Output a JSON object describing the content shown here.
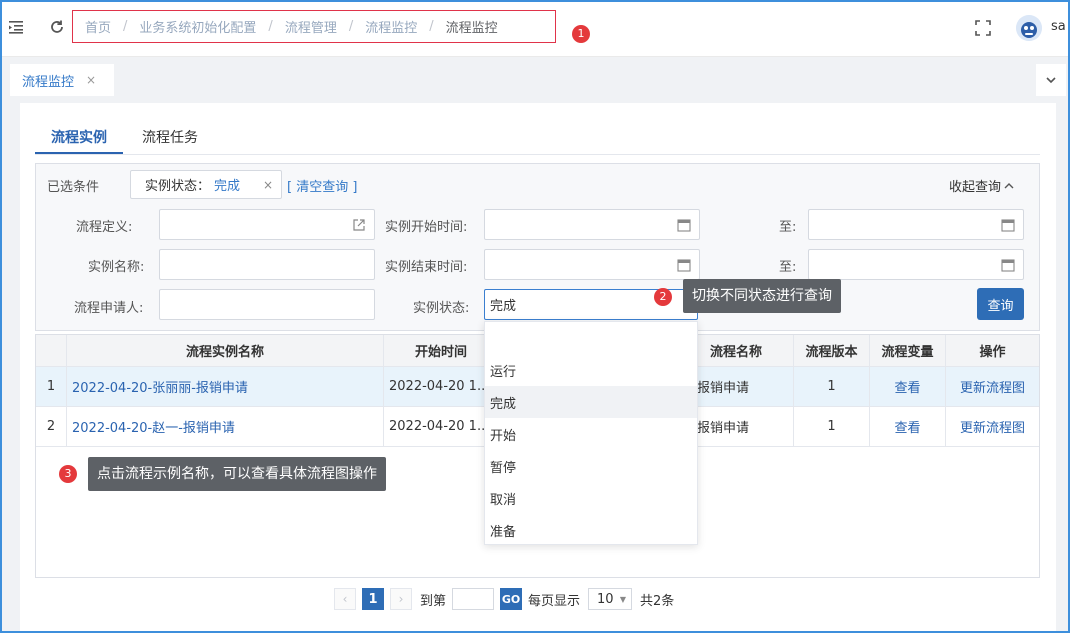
{
  "breadcrumb": [
    "首页",
    "业务系统初始化配置",
    "流程管理",
    "流程监控",
    "流程监控"
  ],
  "breadcrumb_separator": "/",
  "user": {
    "name": "sa"
  },
  "annotations": {
    "n1": "1",
    "n2": "2",
    "n3": "3"
  },
  "tips": {
    "status_switch": "切换不同状态进行查询",
    "click_name": "点击流程示例名称，可以查看具体流程图操作"
  },
  "open_tab": {
    "label": "流程监控",
    "close": "×"
  },
  "subtabs": [
    "流程实例",
    "流程任务"
  ],
  "filter": {
    "selected_label": "已选条件",
    "chip_key": "实例状态：",
    "chip_value": "完成",
    "chip_close": "×",
    "clear_label": "[ 清空查询 ]",
    "collapse_label": "收起查询",
    "fields": {
      "process_def": "流程定义",
      "instance_start": "实例开始时间",
      "to1": "至",
      "instance_name": "实例名称",
      "instance_end": "实例结束时间",
      "to2": "至",
      "applicant": "流程申请人",
      "instance_status": "实例状态"
    },
    "colon": ":",
    "status_value": "完成",
    "query_button": "查询"
  },
  "status_options": [
    "",
    "运行",
    "完成",
    "开始",
    "暂停",
    "取消",
    "准备"
  ],
  "table": {
    "headers": {
      "name": "流程实例名称",
      "start": "开始时间",
      "process": "流程名称",
      "version": "流程版本",
      "vars": "流程变量",
      "op": "操作"
    },
    "rows": [
      {
        "idx": "1",
        "name": "2022-04-20-张丽丽-报销申请",
        "start": "2022-04-20 1...",
        "process": "报销申请",
        "version": "1",
        "vars": "查看",
        "op": "更新流程图"
      },
      {
        "idx": "2",
        "name": "2022-04-20-赵一-报销申请",
        "start": "2022-04-20 1...",
        "process": "报销申请",
        "version": "1",
        "vars": "查看",
        "op": "更新流程图"
      }
    ]
  },
  "pagination": {
    "prev": "‹",
    "current": "1",
    "next": "›",
    "goto_label": "到第",
    "go": "GO",
    "per_page_label": "每页显示",
    "page_size": "10",
    "total": "共2条"
  },
  "colors": {
    "accent": "#2e6db6",
    "link": "#3479c8",
    "badge": "#e4393c",
    "frame": "#3d8fdc"
  }
}
